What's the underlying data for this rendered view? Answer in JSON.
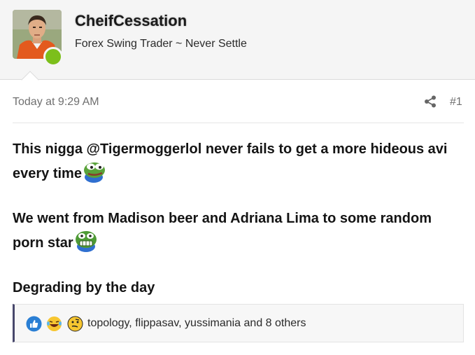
{
  "user": {
    "name": "CheifCessation",
    "title": "Forex Swing Trader ~ Never Settle",
    "online": true,
    "status_color": "#7cbf1b"
  },
  "post": {
    "time": "Today at 9:29 AM",
    "number": "#1",
    "paragraphs": [
      {
        "text": "This nigga @Tigermoggerlol never fails to get a more hideous avi every time",
        "emoji": "pepe-frog-emoji"
      },
      {
        "text": "We went from Madison beer and Adriana Lima to some random porn star",
        "emoji": "pepe-grimace-emoji"
      },
      {
        "text": "Degrading by the day",
        "emoji": ""
      }
    ]
  },
  "reactions": {
    "icons": [
      "like-icon",
      "laughing-crying-icon",
      "smirk-icon"
    ],
    "users_text": "topology, flippasav, yussimania and 8 others"
  },
  "colors": {
    "header_bg": "#f5f5f5",
    "accent_bar": "#47476b",
    "like_blue": "#2a7fd4",
    "emoji_yellow": "#f7c630"
  }
}
